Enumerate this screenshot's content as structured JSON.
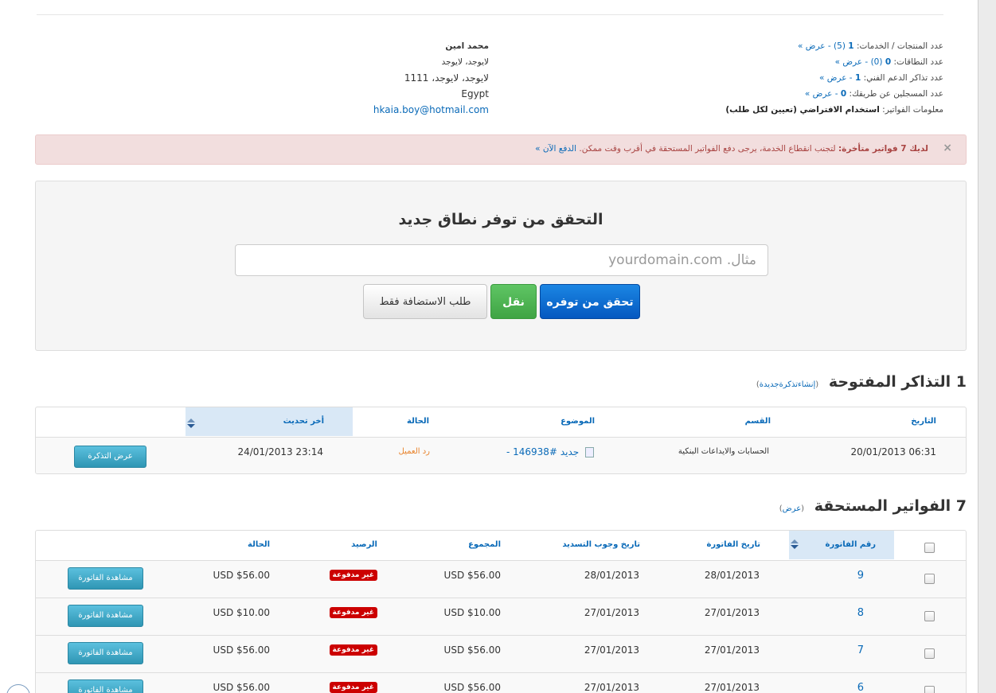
{
  "summary": {
    "products_label": "عدد المنتجات / الخدمات:",
    "products_count": "1",
    "products_extra": "(5)",
    "domains_label": "عدد النطاقات:",
    "domains_count": "0",
    "domains_extra": "(0)",
    "tickets_label": "عدد تذاكر الدعم الفني:",
    "tickets_count": "1",
    "referrals_label": "عدد المسجلين عن طريقك:",
    "referrals_count": "0",
    "view_link": "- عرض »",
    "billing_label": "معلومات الفواتير:",
    "billing_value": "استخدام الافتراضي (تعيين لكل طلب)"
  },
  "address": {
    "name": "محمد امين",
    "line1": "لايوجد، لايوجد",
    "line2": "لايوجد، لايوجد، 1111",
    "country": "Egypt",
    "email": "hkaia.boy@hotmail.com"
  },
  "alert": {
    "close": "×",
    "bold": "لديك 7 فواتير متأخرة:",
    "text": "لتجنب انقطاع الخدمة، يرجى دفع الفواتير المستحقة في أقرب وقت ممكن.",
    "link": "الدفع الآن »"
  },
  "domain_check": {
    "title": "التحقق من توفر نطاق جديد",
    "placeholder": "مثال. yourdomain.com",
    "check_button": "تحقق من توفره",
    "transfer_button": "نقل",
    "hosting_button": "طلب الاستضافة فقط"
  },
  "tickets": {
    "count": "1",
    "title": "التذاكر المفتوحة",
    "new_link": "إنشاءتذكرةجديدة",
    "columns": [
      "التاريخ",
      "القسم",
      "الموضوع",
      "الحالة",
      "أخر تحديث"
    ],
    "rows": [
      {
        "date": "20/01/2013 06:31",
        "department": "الحسابات والايداعات البنكية",
        "subject_id": "#146938",
        "subject_text": "- جديد",
        "status": "رد العميل",
        "last_update": "24/01/2013 23:14",
        "action": "عرض التذكرة"
      }
    ]
  },
  "invoices": {
    "count": "7",
    "title": "الفواتير المستحقة",
    "view_link": "عرض",
    "columns": [
      "رقم الفاتورة",
      "تاريخ الفاتورة",
      "تاريخ وجوب التسديد",
      "المجموع",
      "الرصيد",
      "الحالة"
    ],
    "rows": [
      {
        "id": "9",
        "date": "28/01/2013",
        "due": "28/01/2013",
        "total": "USD $56.00",
        "status": "غير مدفوعة",
        "balance": "USD $56.00",
        "action": "مشاهدة الفاتورة"
      },
      {
        "id": "8",
        "date": "27/01/2013",
        "due": "27/01/2013",
        "total": "USD $10.00",
        "status": "غير مدفوعة",
        "balance": "USD $10.00",
        "action": "مشاهدة الفاتورة"
      },
      {
        "id": "7",
        "date": "27/01/2013",
        "due": "27/01/2013",
        "total": "USD $56.00",
        "status": "غير مدفوعة",
        "balance": "USD $56.00",
        "action": "مشاهدة الفاتورة"
      },
      {
        "id": "6",
        "date": "27/01/2013",
        "due": "27/01/2013",
        "total": "USD $56.00",
        "status": "غير مدفوعة",
        "balance": "USD $56.00",
        "action": "مشاهدة الفاتورة"
      }
    ]
  },
  "colors": {
    "link": "#0a6ab8",
    "alert_bg": "#f2dede",
    "alert_text": "#a94442",
    "primary": "#0458c0",
    "success": "#3fa444",
    "info": "#2f96b4",
    "unpaid": "#cc0000",
    "status_orange": "#e8822a"
  }
}
